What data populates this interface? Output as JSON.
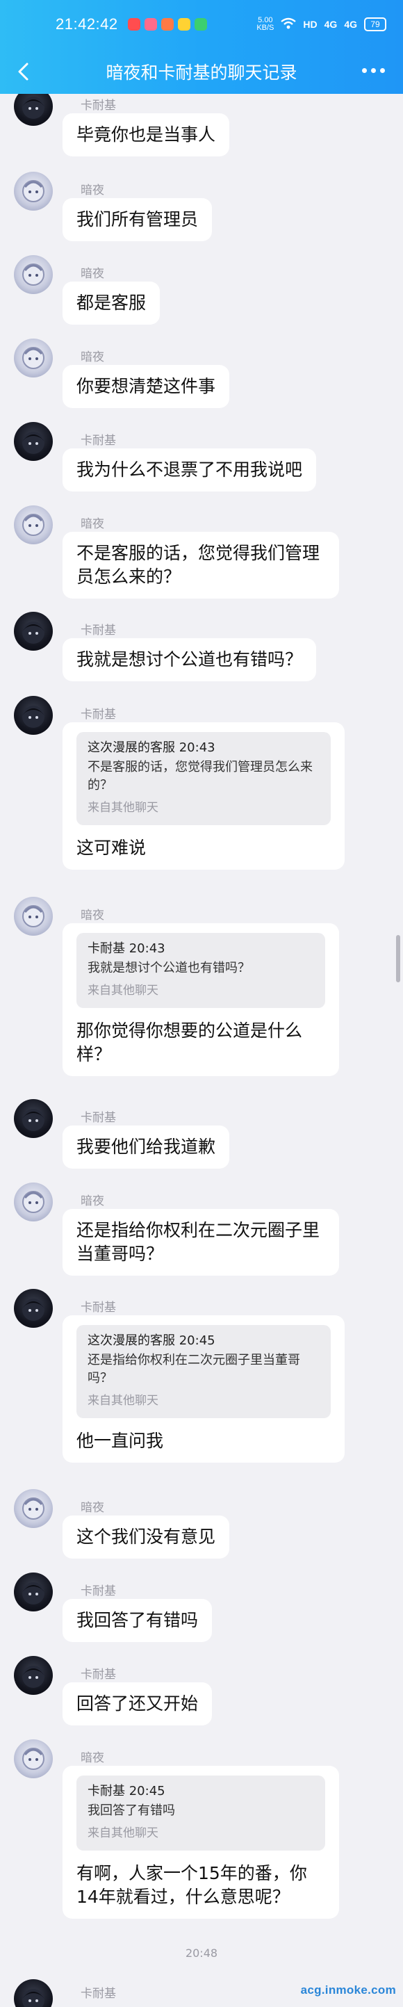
{
  "status_bar": {
    "time": "21:42:42",
    "net_speed": "5.00\nKB/S",
    "signal_1": "4G",
    "signal_2": "4G",
    "wifi_label": "HD",
    "battery": "79"
  },
  "header": {
    "title": "暗夜和卡耐基的聊天记录"
  },
  "messages": [
    {
      "sender": "卡耐基",
      "text": "毕竟你也是当事人"
    },
    {
      "sender": "暗夜",
      "text": "我们所有管理员"
    },
    {
      "sender": "暗夜",
      "text": "都是客服"
    },
    {
      "sender": "暗夜",
      "text": "你要想清楚这件事"
    },
    {
      "sender": "卡耐基",
      "text": "我为什么不退票了不用我说吧"
    },
    {
      "sender": "暗夜",
      "text": "不是客服的话，您觉得我们管理员怎么来的？"
    },
    {
      "sender": "卡耐基",
      "text": "我就是想讨个公道也有错吗？"
    },
    {
      "sender": "卡耐基",
      "text": "这可难说",
      "quote": {
        "head": "这次漫展的客服 20:43",
        "body": "不是客服的话，您觉得我们管理员怎么来的？",
        "foot": "来自其他聊天"
      }
    },
    {
      "sender": "暗夜",
      "text": "那你觉得你想要的公道是什么样？",
      "quote": {
        "head": "卡耐基 20:43",
        "body": "我就是想讨个公道也有错吗？",
        "foot": "来自其他聊天"
      }
    },
    {
      "sender": "卡耐基",
      "text": "我要他们给我道歉"
    },
    {
      "sender": "暗夜",
      "text": "还是指给你权利在二次元圈子里当董哥吗？"
    },
    {
      "sender": "卡耐基",
      "text": "他一直问我",
      "quote": {
        "head": "这次漫展的客服 20:45",
        "body": "还是指给你权利在二次元圈子里当董哥吗？",
        "foot": "来自其他聊天"
      }
    },
    {
      "sender": "暗夜",
      "text": "这个我们没有意见"
    },
    {
      "sender": "卡耐基",
      "text": "我回答了有错吗"
    },
    {
      "sender": "卡耐基",
      "text": "回答了还又开始"
    },
    {
      "sender": "暗夜",
      "text": "有啊，人家一个15年的番，你14年就看过，什么意思呢？",
      "quote": {
        "head": "卡耐基 20:45",
        "body": "我回答了有错吗",
        "foot": "来自其他聊天"
      }
    },
    {
      "sender": "卡耐基",
      "text": ""
    }
  ],
  "timestamp_divider": "20:48",
  "watermark": "acg.inmoke.com",
  "colors": {
    "header_start": "#2fbcf5",
    "header_end": "#1f96f6",
    "background": "#f1f1f5",
    "bubble": "#ffffff",
    "quote_bg": "#ececef"
  }
}
